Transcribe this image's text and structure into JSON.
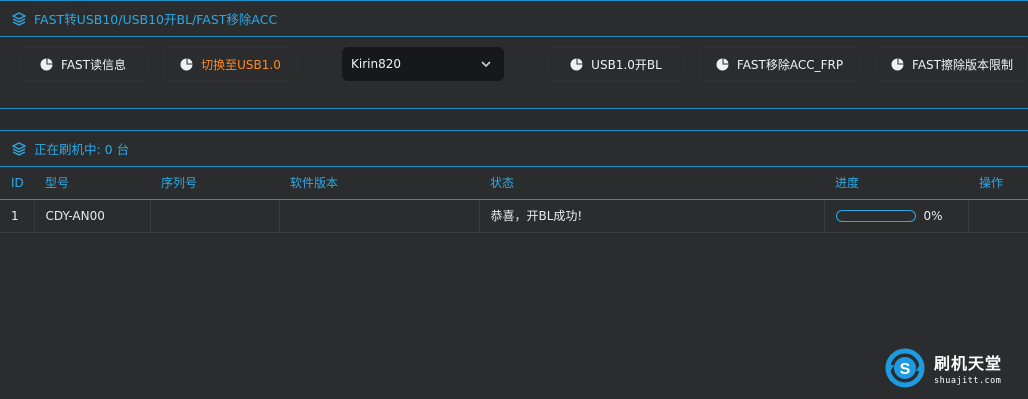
{
  "fast_panel": {
    "title": "FAST转USB10/USB10开BL/FAST移除ACC",
    "buttons": [
      {
        "label": "FAST读信息",
        "active": false
      },
      {
        "label": "切换至USB1.0",
        "active": true
      },
      {
        "label": "USB1.0开BL",
        "active": false
      },
      {
        "label": "FAST移除ACC_FRP",
        "active": false
      },
      {
        "label": "FAST擦除版本限制",
        "active": false
      }
    ],
    "chip_select": {
      "value": "Kirin820"
    }
  },
  "flash_panel": {
    "title": "正在刷机中: 0 台",
    "columns": [
      "ID",
      "型号",
      "序列号",
      "软件版本",
      "状态",
      "进度",
      "操作"
    ],
    "rows": [
      {
        "id": "1",
        "model": "CDY-AN00",
        "serial": "",
        "version": "",
        "status": "恭喜，开BL成功!",
        "progress": 0,
        "progress_text": "0%",
        "action": ""
      }
    ]
  },
  "watermark": {
    "title": "刷机天堂",
    "url": "shuajitt.com"
  },
  "colors": {
    "accent": "#2aa9e6",
    "active_button": "#ff8a1e",
    "background": "#2a2b2c"
  }
}
